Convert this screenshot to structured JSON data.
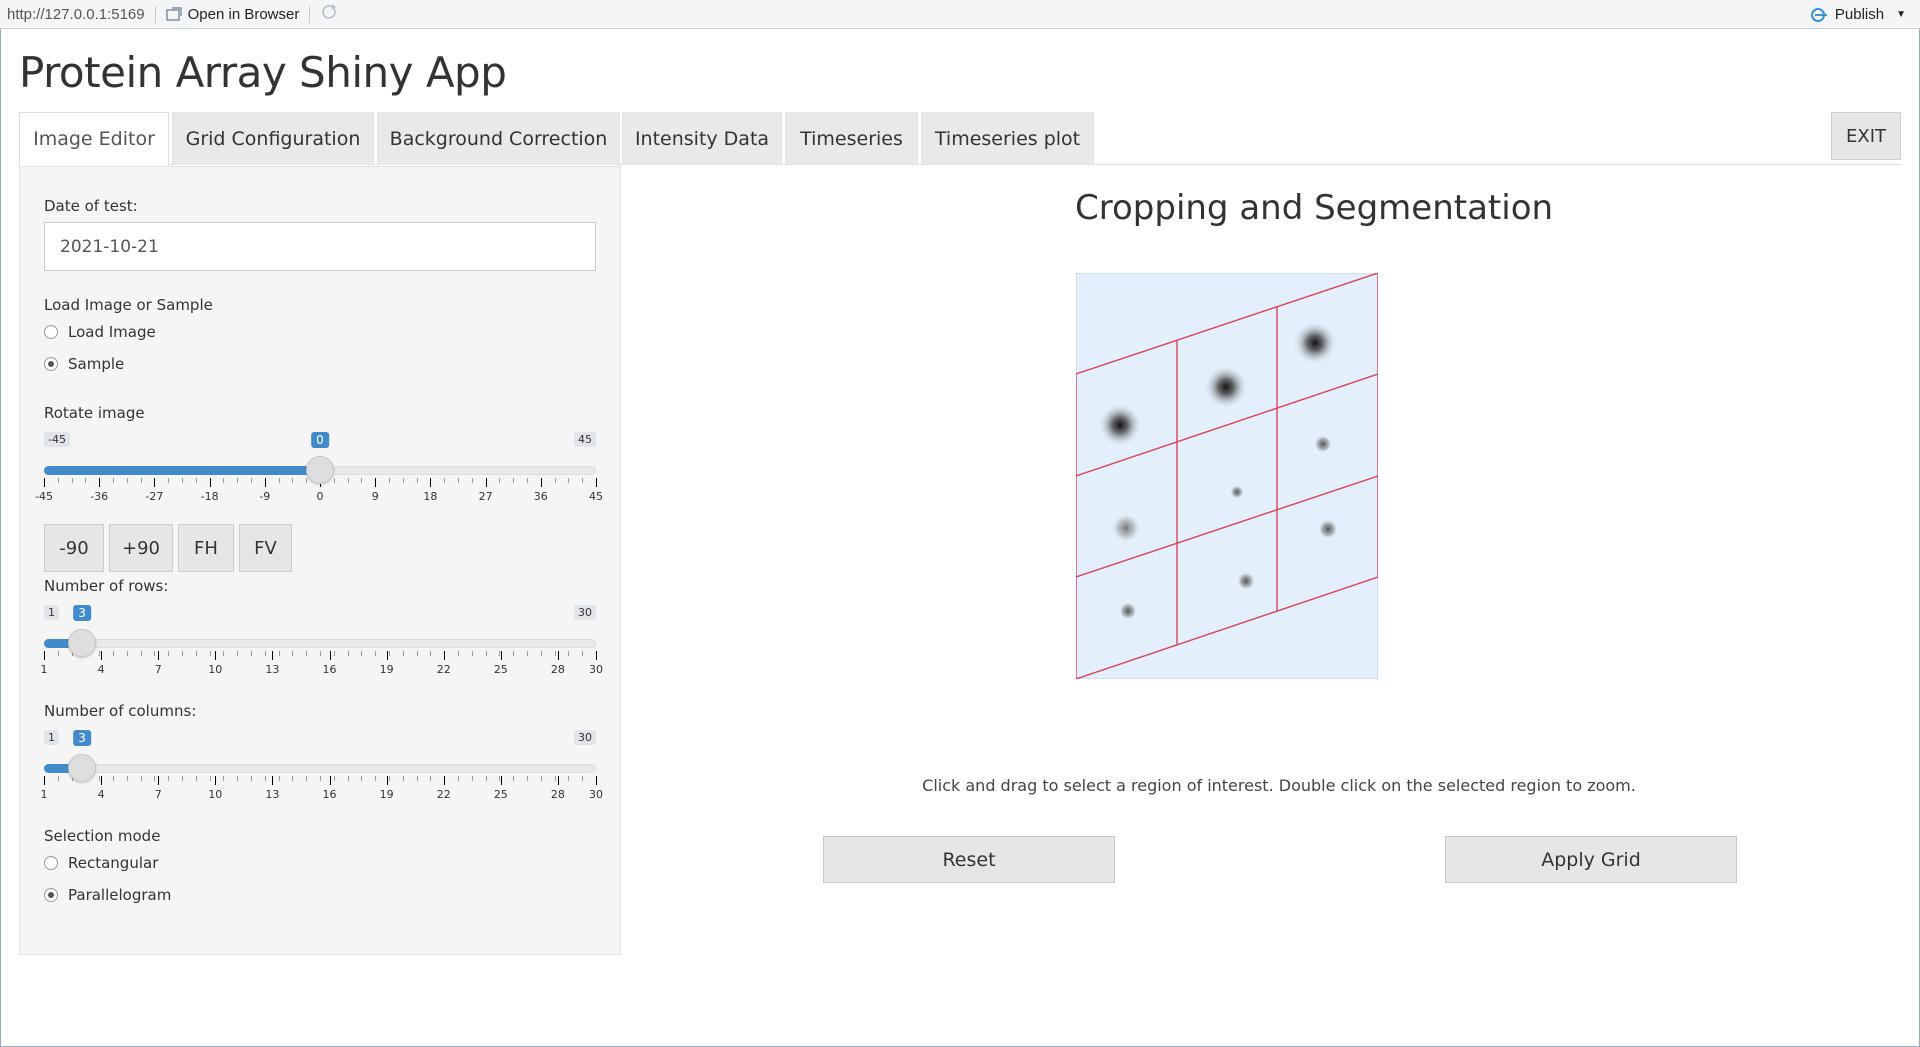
{
  "viewer": {
    "url": "http://127.0.0.1:5169",
    "open_in_browser": "Open in Browser",
    "publish": "Publish"
  },
  "app": {
    "title": "Protein Array Shiny App",
    "tabs": [
      {
        "label": "Image Editor",
        "active": true
      },
      {
        "label": "Grid Configuration"
      },
      {
        "label": "Background Correction"
      },
      {
        "label": "Intensity Data"
      },
      {
        "label": "Timeseries"
      },
      {
        "label": "Timeseries plot"
      }
    ],
    "exit": "EXIT"
  },
  "sidebar": {
    "date_label": "Date of test:",
    "date_value": "2021-10-21",
    "load_label": "Load Image or Sample",
    "load_options": [
      {
        "label": "Load Image",
        "selected": false
      },
      {
        "label": "Sample",
        "selected": true
      }
    ],
    "rotate": {
      "label": "Rotate image",
      "min": "-45",
      "max": "45",
      "value": 0,
      "value_label": "0",
      "ticks": [
        "-45",
        "-36",
        "-27",
        "-18",
        "-9",
        "0",
        "9",
        "18",
        "27",
        "36",
        "45"
      ]
    },
    "buttons": [
      "-90",
      "+90",
      "FH",
      "FV"
    ],
    "rows": {
      "label": "Number of rows:",
      "min": "1",
      "max": "30",
      "value": 3,
      "value_label": "3",
      "ticks": [
        "1",
        "4",
        "7",
        "10",
        "13",
        "16",
        "19",
        "22",
        "25",
        "28",
        "30"
      ]
    },
    "columns": {
      "label": "Number of columns:",
      "min": "1",
      "max": "30",
      "value": 3,
      "value_label": "3",
      "ticks": [
        "1",
        "4",
        "7",
        "10",
        "13",
        "16",
        "19",
        "22",
        "25",
        "28",
        "30"
      ]
    },
    "selection_label": "Selection mode",
    "selection_options": [
      {
        "label": "Rectangular",
        "selected": false
      },
      {
        "label": "Parallelogram",
        "selected": true
      }
    ]
  },
  "main": {
    "title": "Cropping and Segmentation",
    "hint": "Click and drag to select a region of interest. Double click on the selected region to zoom.",
    "reset": "Reset",
    "apply_grid": "Apply Grid"
  },
  "colors": {
    "accent": "#428bca",
    "grid_line": "#d9435a",
    "image_bg": "#e3effb"
  }
}
